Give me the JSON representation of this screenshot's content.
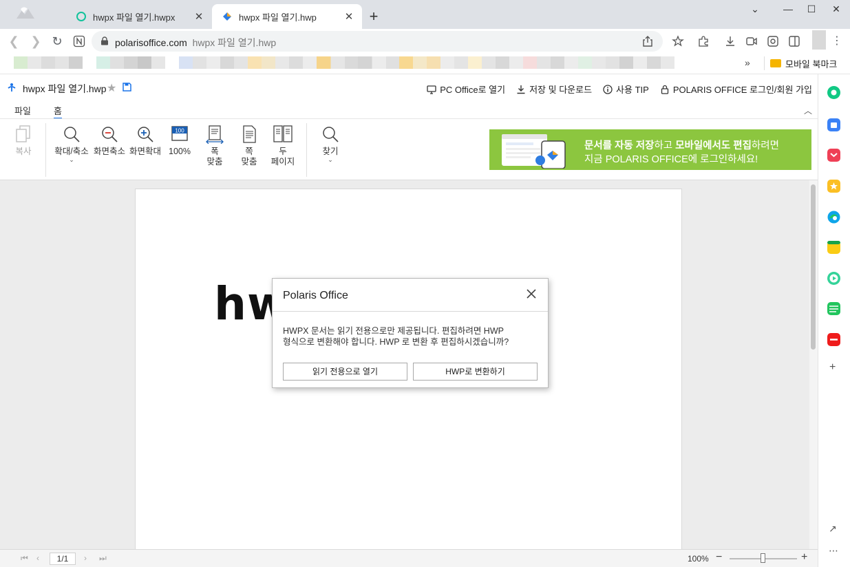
{
  "browser": {
    "tabs": [
      {
        "title": "hwpx 파일 열기.hwpx",
        "active": false
      },
      {
        "title": "hwpx 파일 열기.hwp",
        "active": true
      }
    ],
    "url_host": "polarisoffice.com",
    "url_path": "hwpx 파일 열기.hwp",
    "bookmark_folder": "모바일 북마크",
    "bookmark_more": "»"
  },
  "app": {
    "doc_name": "hwpx 파일 열기.hwp",
    "top_actions": [
      "PC Office로 열기",
      "저장 및 다운로드",
      "사용 TIP",
      "POLARIS OFFICE 로그인/회원 가입"
    ],
    "menu_tabs": [
      "파일",
      "홈"
    ],
    "ribbon": {
      "copy": "복사",
      "zoom_toggle": "확대/축소",
      "zoom_out": "화면축소",
      "zoom_in": "화면확대",
      "zoom_100": "100%",
      "zoom_100_icon_text": "100",
      "fit_width_1": "폭",
      "fit_width_2": "맞춤",
      "fit_page_1": "쪽",
      "fit_page_2": "맞춤",
      "two_page_1": "두",
      "two_page_2": "페이지",
      "find": "찾기"
    },
    "banner": {
      "line1_a": "문서를 자동 저장",
      "line1_b": "하고 ",
      "line1_c": "모바일에서도 편집",
      "line1_d": "하려면",
      "line2": "지금 POLARIS OFFICE에 로그인하세요!"
    },
    "page_text": "hw",
    "status": {
      "page": "1/1",
      "zoom": "100%",
      "zoom_level": 0.5
    }
  },
  "dialog": {
    "title": "Polaris Office",
    "message_line1": "HWPX 문서는 읽기 전용으로만 제공됩니다. 편집하려면 HWP",
    "message_line2": "형식으로 변환해야 합니다. HWP 로 변환 후 편집하시겠습니까?",
    "btn_readonly": "읽기 전용으로 열기",
    "btn_convert": "HWP로 변환하기"
  },
  "colors": {
    "accent": "#1a73e8",
    "banner_green": "#8cc63f",
    "tabstrip": "#dee1e6"
  }
}
